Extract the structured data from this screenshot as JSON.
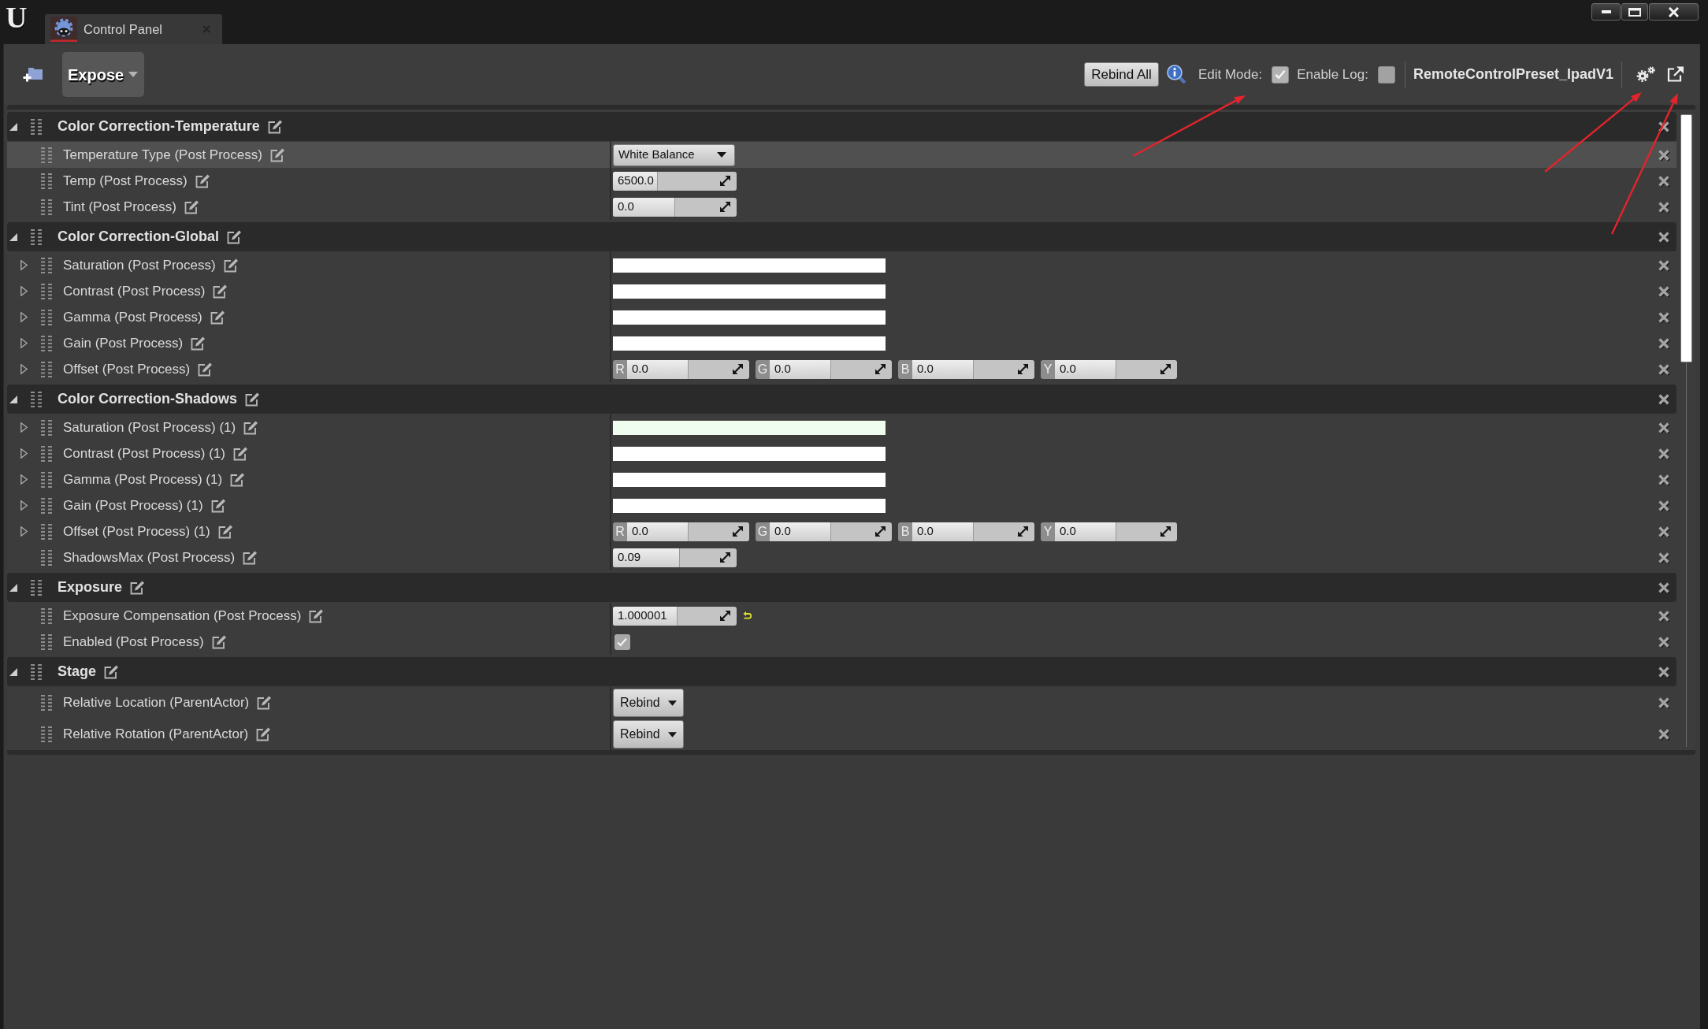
{
  "window": {
    "logo": "U",
    "tab": {
      "title": "Control Panel"
    }
  },
  "toolbar": {
    "expose_button": "Expose",
    "rebind_all_button": "Rebind All",
    "edit_mode": {
      "label": "Edit Mode:",
      "checked": true
    },
    "enable_log": {
      "label": "Enable Log:",
      "checked": false
    },
    "preset_name": "RemoteControlPreset_IpadV1"
  },
  "categories": [
    {
      "title": "Color Correction-Temperature",
      "expanded": true,
      "children": [
        {
          "label": "Temperature Type (Post Process)",
          "kind": "dropdown",
          "selected": true,
          "value": "White Balance"
        },
        {
          "label": "Temp (Post Process)",
          "kind": "number",
          "selected": false,
          "value": "6500.0",
          "level": 0.36,
          "reset": false
        },
        {
          "label": "Tint (Post Process)",
          "kind": "number",
          "selected": false,
          "value": "0.0",
          "level": 0.5,
          "reset": false
        }
      ]
    },
    {
      "title": "Color Correction-Global",
      "expanded": true,
      "children": [
        {
          "label": "Saturation (Post Process)",
          "kind": "color",
          "selected": false,
          "expanded": false,
          "color": "#ffffff"
        },
        {
          "label": "Contrast (Post Process)",
          "kind": "color",
          "selected": false,
          "expanded": false,
          "color": "#ffffff"
        },
        {
          "label": "Gamma (Post Process)",
          "kind": "color",
          "selected": false,
          "expanded": false,
          "color": "#ffffff"
        },
        {
          "label": "Gain (Post Process)",
          "kind": "color",
          "selected": false,
          "expanded": false,
          "color": "#ffffff"
        },
        {
          "label": "Offset (Post Process)",
          "kind": "vector",
          "selected": false,
          "expanded": false,
          "components": [
            {
              "axis": "R",
              "value": "0.0",
              "level": 0.5
            },
            {
              "axis": "G",
              "value": "0.0",
              "level": 0.5
            },
            {
              "axis": "B",
              "value": "0.0",
              "level": 0.5
            },
            {
              "axis": "Y",
              "value": "0.0",
              "level": 0.5
            }
          ]
        }
      ]
    },
    {
      "title": "Color Correction-Shadows",
      "expanded": true,
      "children": [
        {
          "label": "Saturation (Post Process) (1)",
          "kind": "color",
          "selected": false,
          "expanded": false,
          "color": "#eefdf0"
        },
        {
          "label": "Contrast (Post Process) (1)",
          "kind": "color",
          "selected": false,
          "expanded": false,
          "color": "#ffffff"
        },
        {
          "label": "Gamma (Post Process) (1)",
          "kind": "color",
          "selected": false,
          "expanded": false,
          "color": "#ffffff"
        },
        {
          "label": "Gain (Post Process) (1)",
          "kind": "color",
          "selected": false,
          "expanded": false,
          "color": "#ffffff"
        },
        {
          "label": "Offset (Post Process) (1)",
          "kind": "vector",
          "selected": false,
          "expanded": false,
          "components": [
            {
              "axis": "R",
              "value": "0.0",
              "level": 0.5
            },
            {
              "axis": "G",
              "value": "0.0",
              "level": 0.5
            },
            {
              "axis": "B",
              "value": "0.0",
              "level": 0.5
            },
            {
              "axis": "Y",
              "value": "0.0",
              "level": 0.5
            }
          ]
        },
        {
          "label": "ShadowsMax (Post Process)",
          "kind": "number",
          "selected": false,
          "value": "0.09",
          "level": 0.54,
          "reset": false
        }
      ]
    },
    {
      "title": "Exposure",
      "expanded": true,
      "children": [
        {
          "label": "Exposure Compensation (Post Process)",
          "kind": "number",
          "selected": false,
          "value": "1.000001",
          "level": 0.52,
          "reset": true
        },
        {
          "label": "Enabled (Post Process)",
          "kind": "checkbox",
          "selected": false,
          "checked": true
        }
      ]
    },
    {
      "title": "Stage",
      "expanded": true,
      "children": [
        {
          "label": "Relative Location (ParentActor)",
          "kind": "rebind",
          "selected": false,
          "button": "Rebind"
        },
        {
          "label": "Relative Rotation (ParentActor)",
          "kind": "rebind",
          "selected": false,
          "button": "Rebind"
        }
      ]
    }
  ],
  "annotations": [
    {
      "kind": "arrow"
    },
    {
      "kind": "arrow"
    },
    {
      "kind": "arrow"
    }
  ]
}
